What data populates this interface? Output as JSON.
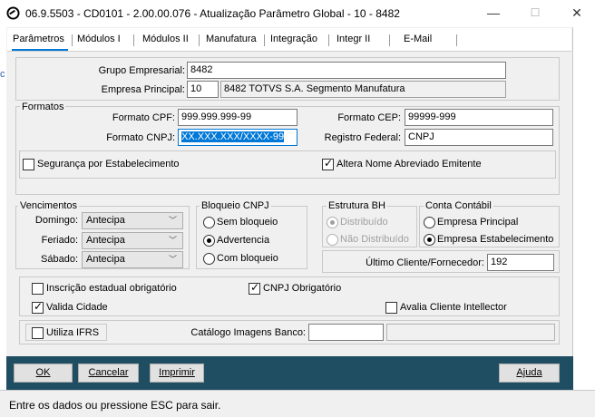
{
  "window": {
    "title": "06.9.5503 - CD0101 - 2.00.00.076 - Atualização Parâmetro Global - 10 - 8482",
    "minimize": "—",
    "maximize": "☐",
    "close": "✕",
    "left_edge_fragment": "c"
  },
  "tabs": [
    {
      "label": "Parâmetros",
      "active": true
    },
    {
      "label": "Módulos I",
      "active": false
    },
    {
      "label": "Módulos II",
      "active": false
    },
    {
      "label": "Manufatura",
      "active": false
    },
    {
      "label": "Integração",
      "active": false
    },
    {
      "label": "Integr II",
      "active": false
    },
    {
      "label": "E-Mail",
      "active": false
    }
  ],
  "header": {
    "grupo_label": "Grupo Empresarial:",
    "grupo_value": "8482",
    "empresa_label": "Empresa Principal:",
    "empresa_code": "10",
    "empresa_name": "8482 TOTVS S.A. Segmento Manufatura"
  },
  "formatos": {
    "title": "Formatos",
    "cpf_label": "Formato CPF:",
    "cpf_value": "999.999.999-99",
    "cep_label": "Formato CEP:",
    "cep_value": "99999-999",
    "cnpj_label": "Formato CNPJ:",
    "cnpj_value": "XX.XXX.XXX/XXXX-99",
    "registro_label": "Registro Federal:",
    "registro_value": "CNPJ",
    "seguranca_label": "Segurança por Estabelecimento",
    "seguranca_checked": false,
    "altera_label": "Altera Nome Abreviado Emitente",
    "altera_checked": true
  },
  "vencimentos": {
    "title": "Vencimentos",
    "domingo_label": "Domingo:",
    "domingo_value": "Antecipa",
    "feriado_label": "Feriado:",
    "feriado_value": "Antecipa",
    "sabado_label": "Sábado:",
    "sabado_value": "Antecipa"
  },
  "bloqueio": {
    "title": "Bloqueio CNPJ",
    "options": [
      "Sem bloqueio",
      "Advertencia",
      "Com bloqueio"
    ],
    "selected": "Advertencia"
  },
  "estrutura": {
    "title": "Estrutura BH",
    "options": [
      "Distribuído",
      "Não Distribuído"
    ],
    "selected": "Distribuído",
    "enabled": false
  },
  "conta": {
    "title": "Conta Contábil",
    "options": [
      "Empresa Principal",
      "Empresa Estabelecimento"
    ],
    "selected": "Empresa Estabelecimento"
  },
  "ultimo": {
    "label": "Último Cliente/Fornecedor:",
    "value": "192"
  },
  "opcoes": {
    "inscricao_label": "Inscrição estadual obrigatório",
    "inscricao_checked": false,
    "cnpj_obrig_label": "CNPJ Obrigatório",
    "cnpj_obrig_checked": true,
    "valida_label": "Valida Cidade",
    "valida_checked": true,
    "avalia_label": "Avalia Cliente Intellector",
    "avalia_checked": false
  },
  "ifrs": {
    "label": "Utiliza IFRS",
    "checked": false,
    "catalogo_label": "Catálogo Imagens Banco:",
    "catalogo_value": "",
    "catalogo_value2": ""
  },
  "buttons": {
    "ok": "OK",
    "cancelar": "Cancelar",
    "imprimir": "Imprimir",
    "ajuda": "Ajuda"
  },
  "status": "Entre os dados ou pressione ESC para sair.",
  "colors": {
    "accent": "#0078d7",
    "button_bar": "#1f4e63",
    "panel": "#f0f0f0"
  }
}
